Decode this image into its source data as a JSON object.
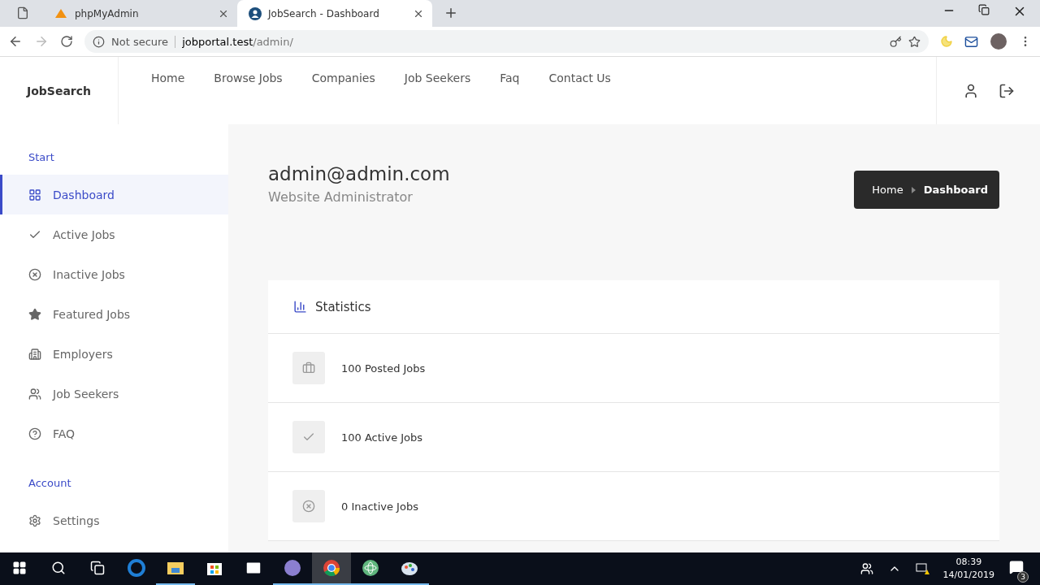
{
  "browser": {
    "tabs": [
      {
        "label": "phpMyAdmin",
        "kind": "pma",
        "selected": false
      },
      {
        "label": "JobSearch - Dashboard",
        "kind": "site",
        "selected": true
      }
    ],
    "security": "Not secure",
    "url_host": "jobportal.test",
    "url_path": "/admin/"
  },
  "header": {
    "brand": "JobSearch",
    "nav": [
      "Home",
      "Browse Jobs",
      "Companies",
      "Job Seekers",
      "Faq",
      "Contact Us"
    ]
  },
  "sidebar": {
    "sections": [
      {
        "title": "Start",
        "items": [
          {
            "label": "Dashboard",
            "kind": "dashboard",
            "selected": true
          },
          {
            "label": "Active Jobs",
            "kind": "check",
            "selected": false
          },
          {
            "label": "Inactive Jobs",
            "kind": "cross",
            "selected": false
          },
          {
            "label": "Featured Jobs",
            "kind": "star",
            "selected": false
          },
          {
            "label": "Employers",
            "kind": "building",
            "selected": false
          },
          {
            "label": "Job Seekers",
            "kind": "people",
            "selected": false
          },
          {
            "label": "FAQ",
            "kind": "question",
            "selected": false
          }
        ]
      },
      {
        "title": "Account",
        "items": [
          {
            "label": "Settings",
            "kind": "gear",
            "selected": false
          }
        ]
      }
    ]
  },
  "page": {
    "title": "admin@admin.com",
    "subtitle": "Website Administrator",
    "breadcrumb": [
      "Home",
      "Dashboard"
    ]
  },
  "statistics": {
    "title": "Statistics",
    "rows": [
      {
        "label": "100 Posted Jobs",
        "kind": "briefcase"
      },
      {
        "label": "100 Active Jobs",
        "kind": "check"
      },
      {
        "label": "0 Inactive Jobs",
        "kind": "cross"
      }
    ]
  },
  "taskbar": {
    "apps": [
      {
        "kind": "edge",
        "running": false,
        "selected": false
      },
      {
        "kind": "folder",
        "running": true,
        "selected": false
      },
      {
        "kind": "store",
        "running": false,
        "selected": false
      },
      {
        "kind": "mail",
        "running": false,
        "selected": false
      },
      {
        "kind": "torrent",
        "running": true,
        "selected": false
      },
      {
        "kind": "chrome",
        "running": true,
        "selected": true
      },
      {
        "kind": "atom",
        "running": true,
        "selected": false
      },
      {
        "kind": "paint",
        "running": true,
        "selected": false
      }
    ],
    "time": "08:39",
    "date": "14/01/2019",
    "notifications": "3"
  }
}
